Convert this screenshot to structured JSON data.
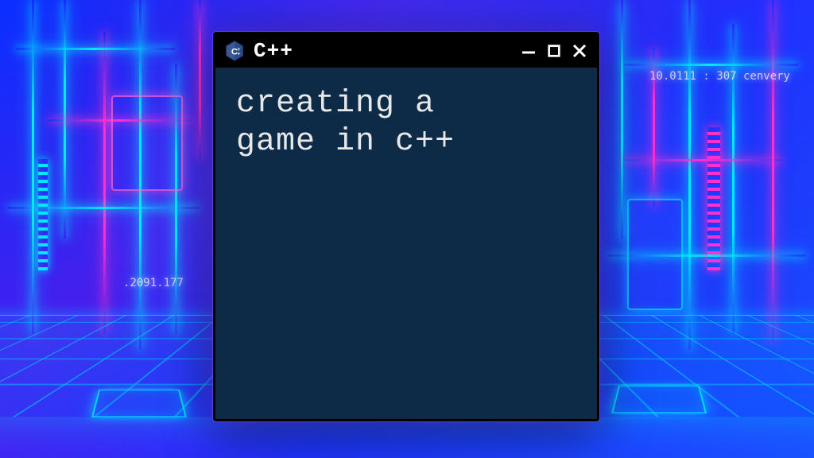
{
  "window": {
    "title": "C++",
    "icon_label": "C++",
    "body_text": "creating a\ngame in c++"
  },
  "background": {
    "decorative_text_left": ".2091.177",
    "decorative_text_right": "10.0111 : 307  cenvery"
  },
  "colors": {
    "window_bg": "#0d2a47",
    "titlebar_bg": "#000000",
    "text": "#e8e8e8",
    "neon_cyan": "#00eaff",
    "neon_pink": "#ff2fd0"
  }
}
